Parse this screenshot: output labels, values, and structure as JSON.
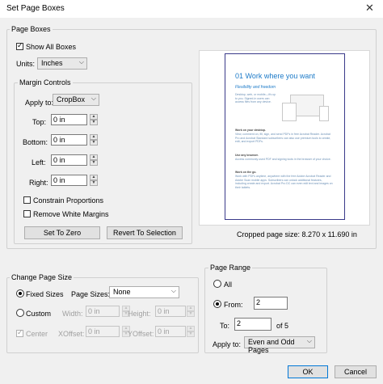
{
  "window": {
    "title": "Set Page Boxes",
    "close_glyph": "✕"
  },
  "page_boxes": {
    "legend": "Page Boxes",
    "show_all_boxes_label": "Show All Boxes",
    "show_all_boxes_checked": true,
    "units_label": "Units:",
    "units_value": "Inches"
  },
  "margin_controls": {
    "legend": "Margin Controls",
    "apply_to_label": "Apply to:",
    "apply_to_value": "CropBox",
    "top_label": "Top:",
    "top_value": "0 in",
    "bottom_label": "Bottom:",
    "bottom_value": "0 in",
    "left_label": "Left:",
    "left_value": "0 in",
    "right_label": "Right:",
    "right_value": "0 in",
    "constrain_label": "Constrain Proportions",
    "remove_white_label": "Remove White Margins",
    "set_to_zero": "Set To Zero",
    "revert": "Revert To Selection"
  },
  "preview": {
    "heading": "01 Work where you want",
    "subheading": "Flexibility and freedom",
    "intro": "Desktop, web, or mobile—it's up to you. Signed-in users can access files from any device.",
    "section1_title": "Work on your desktop.",
    "section1_body": "View, comment on, fill, sign, and send PDFs in free Acrobat Reader. Acrobat Pro and Acrobat Standard subscribers can also use premium tools to create, edit, and export PDFs.",
    "section2_title": "Use any browser.",
    "section2_body": "Access commonly used PDF and signing tools in the browser of your choice.",
    "section3_title": "Work on the go.",
    "section3_body": "Work with PDFs anytime, anywhere with the free Adobe Acrobat Reader and Adobe Scan mobile apps. Subscribers can unlock additional features, including create and export. Acrobat Pro DC can even edit text and images on their tablets.",
    "caption": "Cropped page size: 8.270 x 11.690 in",
    "accent_color": "#1c7ac8"
  },
  "change_page_size": {
    "legend": "Change Page Size",
    "fixed_label": "Fixed Sizes",
    "page_sizes_label": "Page Sizes:",
    "page_sizes_value": "None",
    "custom_label": "Custom",
    "width_label": "Width:",
    "width_value": "0 in",
    "height_label": "Height:",
    "height_value": "0 in",
    "center_label": "Center",
    "xoffset_label": "XOffset:",
    "xoffset_value": "0 in",
    "yoffset_label": "YOffset:",
    "yoffset_value": "0 in"
  },
  "page_range": {
    "legend": "Page Range",
    "all_label": "All",
    "from_label": "From:",
    "from_value": "2",
    "to_label": "To:",
    "to_value": "2",
    "of_text": "of 5",
    "apply_to_label": "Apply to:",
    "apply_to_value": "Even and Odd Pages"
  },
  "buttons": {
    "ok": "OK",
    "cancel": "Cancel"
  }
}
